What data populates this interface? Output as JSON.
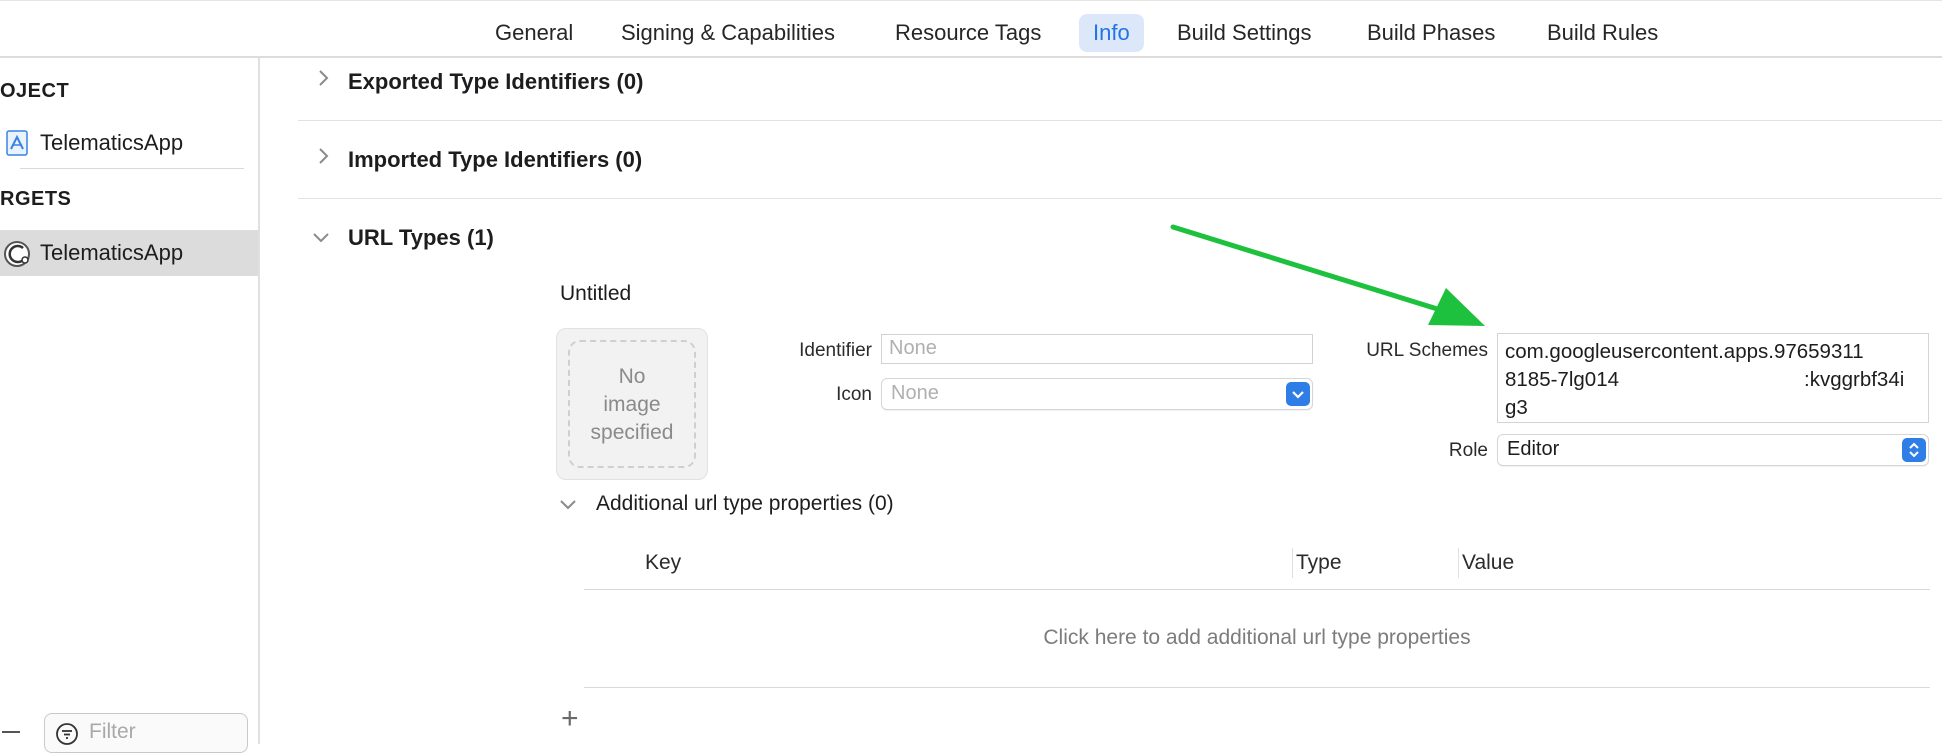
{
  "tabs": [
    {
      "label": "General"
    },
    {
      "label": "Signing & Capabilities"
    },
    {
      "label": "Resource Tags"
    },
    {
      "label": "Info",
      "active": true
    },
    {
      "label": "Build Settings"
    },
    {
      "label": "Build Phases"
    },
    {
      "label": "Build Rules"
    }
  ],
  "sidebar": {
    "project_header": "OJECT",
    "project_item": "TelematicsApp",
    "targets_header": "RGETS",
    "target_item": "TelematicsApp",
    "filter_placeholder": "Filter"
  },
  "sections": {
    "exported": "Exported Type Identifiers (0)",
    "imported": "Imported Type Identifiers (0)",
    "url_types": "URL Types (1)"
  },
  "url_type": {
    "name": "Untitled",
    "image_placeholder": "No\nimage\nspecified",
    "identifier_label": "Identifier",
    "identifier_placeholder": "None",
    "icon_label": "Icon",
    "icon_value": "None",
    "url_schemes_label": "URL Schemes",
    "url_scheme_line1": "com.googleusercontent.apps.97659311",
    "url_scheme_line2a": "8185-7lg014",
    "url_scheme_line2b": ":kvggrbf34i",
    "url_scheme_line3": "g3",
    "role_label": "Role",
    "role_value": "Editor"
  },
  "additional": {
    "title": "Additional url type properties (0)",
    "columns": [
      "Key",
      "Type",
      "Value"
    ],
    "empty_message": "Click here to add additional url type properties",
    "add_symbol": "+"
  },
  "colors": {
    "accent": "#2f7ee8",
    "annotation_arrow": "#1ec13e",
    "selected_tab_bg": "#dce8fa"
  }
}
